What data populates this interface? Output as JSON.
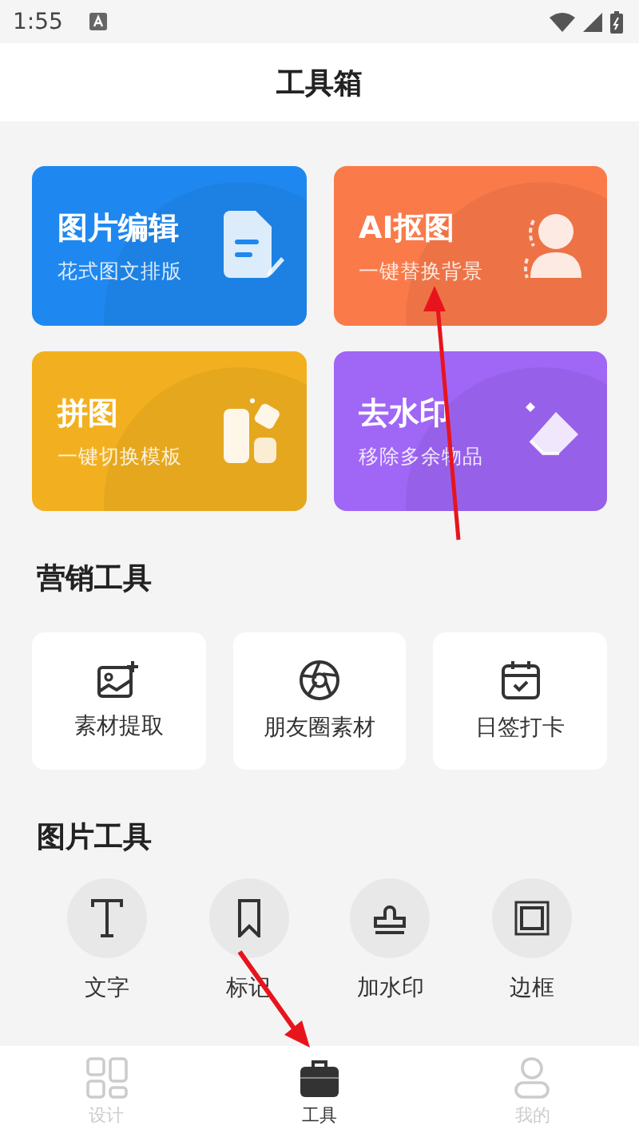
{
  "status_bar": {
    "time": "1:55"
  },
  "title": "工具箱",
  "feature_cards": [
    {
      "title": "图片编辑",
      "subtitle": "花式图文排版",
      "kind": "edit",
      "color": "#1e88f0"
    },
    {
      "title": "AI抠图",
      "subtitle": "一键替换背景",
      "kind": "cutout",
      "color": "#fa7a4a"
    },
    {
      "title": "拼图",
      "subtitle": "一键切换模板",
      "kind": "collage",
      "color": "#f2b020"
    },
    {
      "title": "去水印",
      "subtitle": "移除多余物品",
      "kind": "eraser",
      "color": "#a066f6"
    }
  ],
  "marketing": {
    "title": "营销工具",
    "items": [
      {
        "label": "素材提取",
        "kind": "image"
      },
      {
        "label": "朋友圈素材",
        "kind": "aperture"
      },
      {
        "label": "日签打卡",
        "kind": "calendar"
      }
    ]
  },
  "image_tools": {
    "title": "图片工具",
    "items": [
      {
        "label": "文字",
        "kind": "text"
      },
      {
        "label": "标记",
        "kind": "bookmark"
      },
      {
        "label": "加水印",
        "kind": "stamp"
      },
      {
        "label": "边框",
        "kind": "frame"
      }
    ]
  },
  "bottom_nav": [
    {
      "label": "设计",
      "kind": "grid",
      "selected": false
    },
    {
      "label": "工具",
      "kind": "briefcase",
      "selected": true
    },
    {
      "label": "我的",
      "kind": "person",
      "selected": false
    }
  ]
}
